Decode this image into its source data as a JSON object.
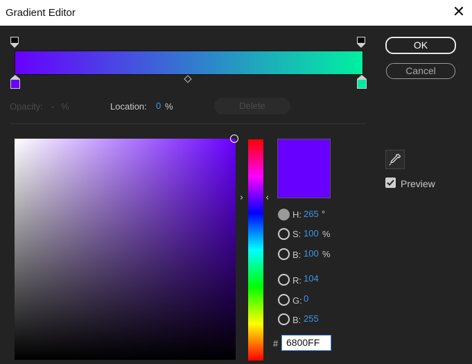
{
  "window": {
    "title": "Gradient Editor",
    "close_glyph": "✕"
  },
  "buttons": {
    "ok": "OK",
    "cancel": "Cancel"
  },
  "gradient": {
    "start_color": "#6800ff",
    "end_color": "#00f0a0",
    "start_stop_swatch": "#6800ff",
    "end_stop_swatch": "#00e8a0"
  },
  "stop_controls": {
    "opacity_label": "Opacity:",
    "opacity_value": "-",
    "opacity_unit": "%",
    "location_label": "Location:",
    "location_value": "0",
    "location_unit": "%",
    "delete_label": "Delete"
  },
  "picker": {
    "current_color": "#6800ff",
    "h_label": "H:",
    "h_value": "265",
    "h_unit": "°",
    "s_label": "S:",
    "s_value": "100",
    "s_unit": "%",
    "b_label": "B:",
    "b_value": "100",
    "b_unit": "%",
    "r_label": "R:",
    "r_value": "104",
    "g_label": "G:",
    "g_value": "0",
    "bl_label": "B:",
    "bl_value": "255",
    "hex_prefix": "#",
    "hex_value": "6800FF"
  },
  "preview": {
    "label": "Preview",
    "checked": true
  },
  "icons": {
    "close": "close-icon",
    "eyedropper": "eyedropper-icon",
    "hue_left": "‹",
    "hue_right": "›",
    "hue_left_arrow": "›",
    "hue_right_arrow": "‹"
  },
  "colors": {
    "accent_blue": "#3e97e8",
    "background": "#232323"
  }
}
